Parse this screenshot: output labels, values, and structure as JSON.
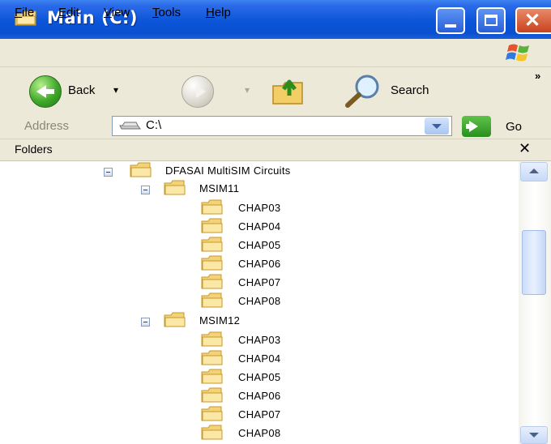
{
  "window": {
    "title": "Main (C:)",
    "close_glyph": "✕"
  },
  "menu": [
    {
      "label": "File"
    },
    {
      "label": "Edit"
    },
    {
      "label": "View"
    },
    {
      "label": "Tools"
    },
    {
      "label": "Help"
    }
  ],
  "toolbar": {
    "back_label": "Back",
    "dropdown_glyph": "▾",
    "search_label": "Search",
    "more_glyph": "»"
  },
  "address": {
    "label": "Address",
    "value": "C:\\",
    "go_label": "Go"
  },
  "folders_panel": {
    "title": "Folders",
    "close_glyph": "✕"
  },
  "tree": {
    "root": "DFASAI MultiSIM Circuits",
    "groups": [
      {
        "name": "MSIM11",
        "children": [
          "CHAP03",
          "CHAP04",
          "CHAP05",
          "CHAP06",
          "CHAP07",
          "CHAP08"
        ]
      },
      {
        "name": "MSIM12",
        "children": [
          "CHAP03",
          "CHAP04",
          "CHAP05",
          "CHAP06",
          "CHAP07",
          "CHAP08"
        ]
      }
    ]
  },
  "colors": {
    "titlebar": "#0b55d8",
    "chrome": "#ece9d8",
    "folder": "#f3d27a"
  },
  "icons": {
    "title": "folder-icon",
    "back": "back-arrow-icon",
    "forward": "forward-arrow-icon",
    "up": "up-folder-icon",
    "search": "magnifier-icon",
    "drive": "drive-icon",
    "go": "go-arrow-icon",
    "tree_folder": "folder-icon",
    "expander": "collapse-minus-icon"
  }
}
